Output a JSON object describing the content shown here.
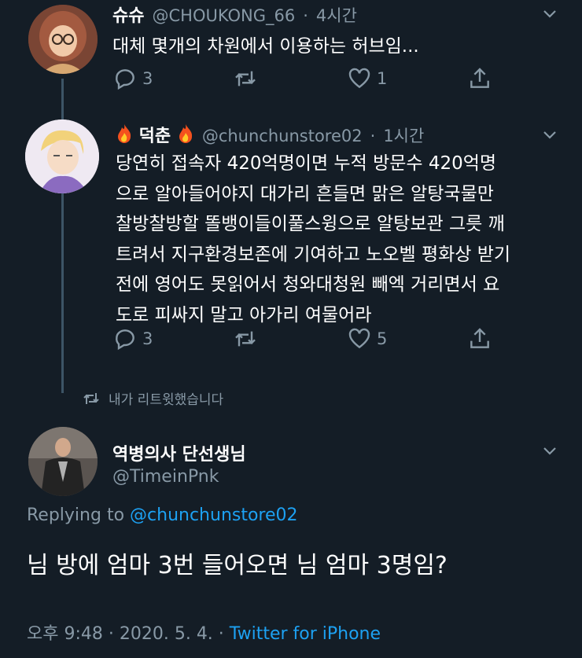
{
  "tweet1": {
    "name": "슈슈",
    "handle": "@CHOUKONG_66",
    "sep": "·",
    "time": "4시간",
    "text": "대체 몇개의 차원에서 이용하는 허브임...",
    "reply_count": "3",
    "retweet_count": "",
    "like_count": "1"
  },
  "tweet2": {
    "name": "덕춘",
    "handle": "@chunchunstore02",
    "sep": "·",
    "time": "1시간",
    "lines": [
      "당연히 접속자 420억명이면 누적 방문수 420억명",
      "으로 알아들어야지 대가리 흔들면 맑은 알탕국물만",
      "찰방찰방할 똘뱅이들이풀스윙으로 알탕보관 그릇 깨",
      "트려서 지구환경보존에 기여하고 노오벨 평화상 받기",
      "전에 영어도 못읽어서 청와대청원 빼엑 거리면서 요",
      "도로 피싸지 말고 아가리 여물어라"
    ],
    "reply_count": "3",
    "like_count": "5"
  },
  "retweet_notice": "내가 리트윗했습니다",
  "main_tweet": {
    "name": "역병의사 단선생님",
    "handle": "@TimeinPnk",
    "replying_prefix": "Replying to",
    "replying_to": "@chunchunstore02",
    "text": "님 방에 엄마 3번 들어오면 님 엄마 3명임?",
    "timestamp": "오후 9:48 · 2020. 5. 4. · ",
    "source": "Twitter for iPhone"
  },
  "colors": {
    "background": "#141d26",
    "secondary_text": "#8899a6",
    "link": "#1da1f2",
    "thread_line": "#3d5466"
  }
}
